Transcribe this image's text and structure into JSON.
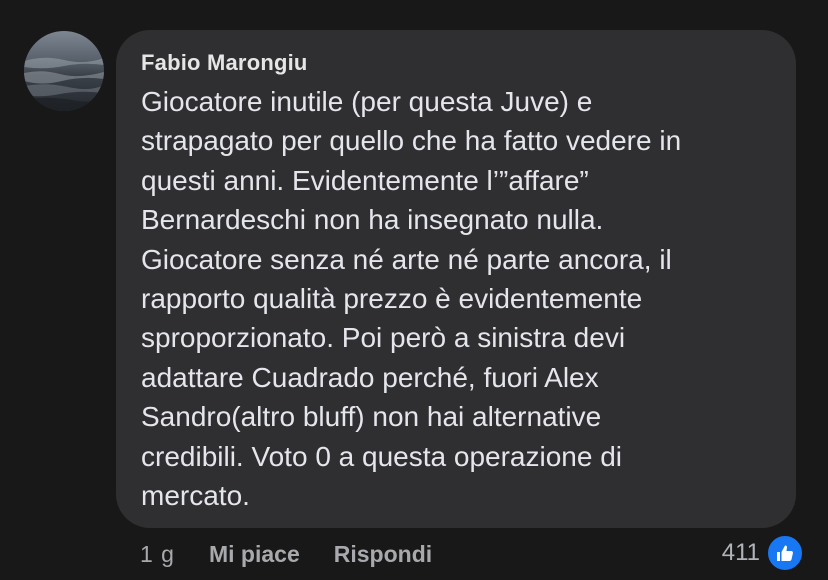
{
  "comment": {
    "author": "Fabio Marongiu",
    "lines": [
      "Giocatore inutile (per questa Juve) e",
      "strapagato per quello che ha fatto vedere in",
      "questi anni. Evidentemente l’”affare”",
      "Bernardeschi non ha insegnato nulla.",
      "Giocatore senza né arte né parte ancora, il",
      "rapporto qualità prezzo è evidentemente",
      "sproporzionato. Poi però a sinistra devi",
      "adattare Cuadrado perché, fuori Alex",
      "Sandro(altro bluff) non hai alternative",
      "credibili. Voto 0 a questa operazione di",
      "mercato."
    ]
  },
  "actions": {
    "timestamp": "1 g",
    "like_label": "Mi piace",
    "reply_label": "Rispondi"
  },
  "reactions": {
    "count": "411",
    "icon": "like-reaction-icon",
    "color": "#1877f2"
  },
  "avatar": {
    "icon": "avatar-sky-icon"
  }
}
